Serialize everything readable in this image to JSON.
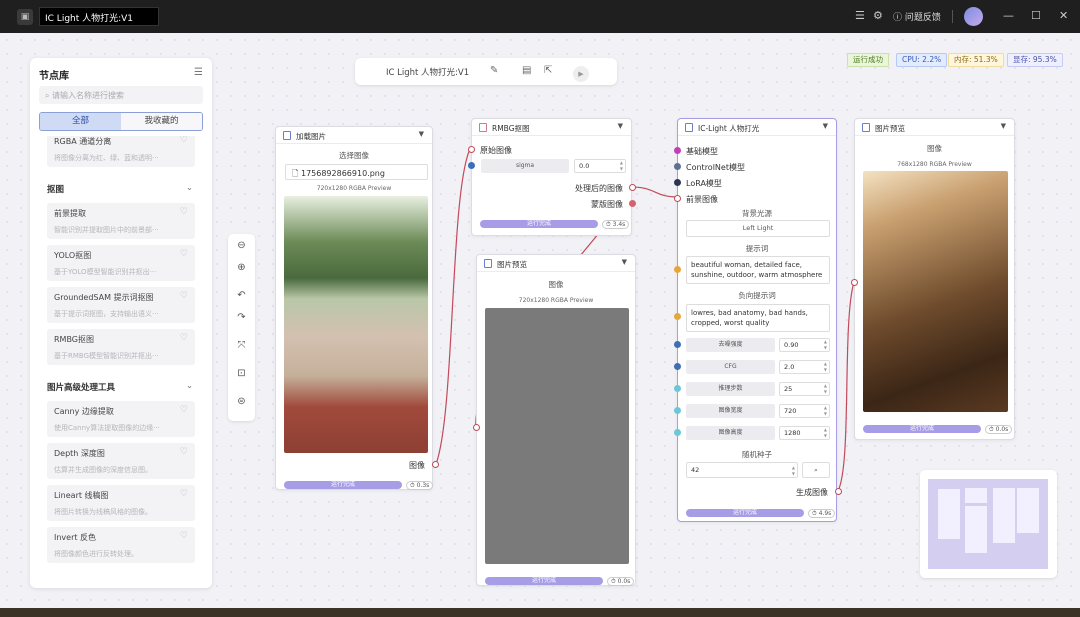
{
  "titlebar": {
    "tab_title": "IC Light 人物打光:V1",
    "help_label": "问题反馈"
  },
  "workflow": {
    "name": "IC Light 人物打光:V1"
  },
  "status": {
    "run": {
      "label": "运行成功",
      "bg": "#eaf5dc",
      "border": "#c9e2a8",
      "color": "#4d7a1e"
    },
    "cpu": {
      "label": "CPU: 2.2%",
      "bg": "#e3ecff",
      "border": "#b6c9f2",
      "color": "#3658b8"
    },
    "mem": {
      "label": "内存: 51.3%",
      "bg": "#fff6dc",
      "border": "#f0dba0",
      "color": "#8a6a16"
    },
    "vram": {
      "label": "显存: 95.3%",
      "bg": "#eef0ff",
      "border": "#c8ccf2",
      "color": "#4a4fa8"
    }
  },
  "sidebar": {
    "title": "节点库",
    "search_placeholder": "请输入名称进行搜索",
    "tabs": [
      "全部",
      "我收藏的"
    ],
    "items_top": [
      {
        "title": "RGBA 通道分离",
        "desc": "将图像分离为红、绿、蓝和透明···"
      }
    ],
    "cat1": "抠图",
    "items_cat1": [
      {
        "title": "前景提取",
        "desc": "智能识别并提取图片中的前景部···"
      },
      {
        "title": "YOLO抠图",
        "desc": "基于YOLO模型智能识别并抠出···"
      },
      {
        "title": "GroundedSAM 提示词抠图",
        "desc": "基于提示词抠图，支持输出语义···"
      },
      {
        "title": "RMBG抠图",
        "desc": "基于RMBG模型智能识别并抠出···"
      }
    ],
    "cat2": "图片高级处理工具",
    "items_cat2": [
      {
        "title": "Canny 边缘提取",
        "desc": "使用Canny算法提取图像的边缘···"
      },
      {
        "title": "Depth 深度图",
        "desc": "估算并生成图像的深度信息图。"
      },
      {
        "title": "Lineart 线稿图",
        "desc": "将图片转换为线稿风格的图像。"
      },
      {
        "title": "Invert 反色",
        "desc": "将图像颜色进行反转处理。"
      }
    ]
  },
  "nodes": {
    "load": {
      "title": "加载图片",
      "select_label": "选择图像",
      "filename": "1756892866910.png",
      "preview": "720x1280 RGBA Preview",
      "out_label": "图像",
      "progress": "运行完成",
      "time": "0.3s"
    },
    "rmbg": {
      "title": "RMBG抠图",
      "in_label": "原始图像",
      "sigma_label": "sigma",
      "sigma_value": "0.0",
      "out1": "处理后的图像",
      "out2": "蒙版图像",
      "progress": "运行完成",
      "time": "3.4s"
    },
    "preview1": {
      "title": "图片预览",
      "label": "图像",
      "preview": "720x1280 RGBA Preview",
      "progress": "运行完成",
      "time": "0.0s"
    },
    "iclight": {
      "title": "IC-Light 人物打光",
      "inputs": [
        "基础模型",
        "ControlNet模型",
        "LoRA模型",
        "前景图像"
      ],
      "bg_light_label": "背景光源",
      "bg_light_value": "Left Light",
      "prompt_label": "提示词",
      "prompt_value": "beautiful woman, detailed face, sunshine, outdoor, warm atmosphere",
      "neg_label": "负向提示词",
      "neg_value": "lowres, bad anatomy, bad hands, cropped, worst quality",
      "params": [
        {
          "label": "去噪强度",
          "value": "0.90"
        },
        {
          "label": "CFG",
          "value": "2.0"
        },
        {
          "label": "推理步数",
          "value": "25"
        },
        {
          "label": "图像宽度",
          "value": "720"
        },
        {
          "label": "图像高度",
          "value": "1280"
        }
      ],
      "seed_label": "随机种子",
      "seed_value": "42",
      "out_label": "生成图像",
      "progress": "运行完成",
      "time": "4.9s"
    },
    "preview2": {
      "title": "图片预览",
      "label": "图像",
      "preview": "768x1280 RGBA Preview",
      "progress": "运行完成",
      "time": "0.0s"
    }
  },
  "colors": {
    "accent": "#a79de6",
    "wire": "#c24b5a",
    "port_purple": "#c03fb7",
    "port_slate": "#5d6f93",
    "port_navy": "#2b3552",
    "port_amber": "#e4a83a",
    "port_blue": "#3d6fb6",
    "port_cyan": "#6ac8d8"
  }
}
